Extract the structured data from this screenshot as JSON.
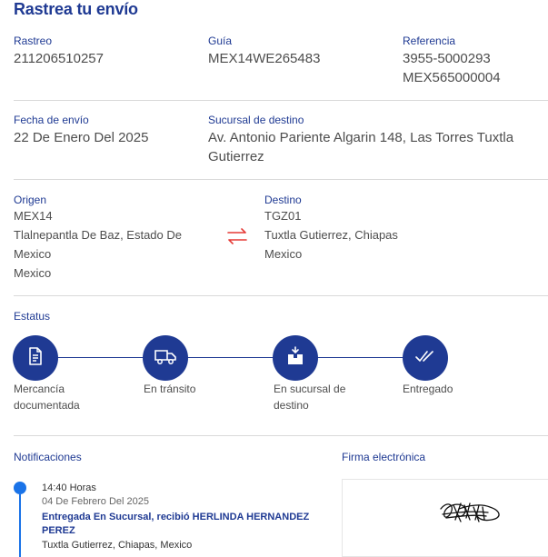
{
  "page": {
    "title": "Rastrea tu envío"
  },
  "shipment": {
    "rastreo_label": "Rastreo",
    "rastreo_value": "211206510257",
    "guia_label": "Guía",
    "guia_value": "MEX14WE265483",
    "referencia_label": "Referencia",
    "referencia_value_1": "3955-5000293",
    "referencia_value_2": "MEX565000004",
    "fecha_label": "Fecha de envío",
    "fecha_value": "22 De Enero Del 2025",
    "sucursal_label": "Sucursal de destino",
    "sucursal_value_1": "Av. Antonio Pariente Algarin 148, Las Torres Tuxtla",
    "sucursal_value_2": "Gutierrez"
  },
  "route": {
    "origen_label": "Origen",
    "origen_code": "MEX14",
    "origen_line_1": "Tlalnepantla De Baz, Estado De",
    "origen_line_2": "Mexico",
    "origen_line_3": "Mexico",
    "destino_label": "Destino",
    "destino_code": "TGZ01",
    "destino_line_1": "Tuxtla Gutierrez, Chiapas",
    "destino_line_2": "Mexico",
    "swap_icon": "swap-arrows-icon",
    "swap_color": "#e53935"
  },
  "status": {
    "label": "Estatus",
    "steps": [
      {
        "line_1": "Mercancía",
        "line_2": "documentada",
        "icon": "document-icon"
      },
      {
        "line_1": "En tránsito",
        "line_2": "",
        "icon": "truck-icon"
      },
      {
        "line_1": "En sucursal de",
        "line_2": "destino",
        "icon": "box-icon"
      },
      {
        "line_1": "Entregado",
        "line_2": "",
        "icon": "double-check-icon"
      }
    ],
    "accent": "#1f3a93"
  },
  "notifications": {
    "label": "Notificaciones",
    "events": [
      {
        "time": "14:40 Horas",
        "date": "04 De Febrero Del 2025",
        "desc": "Entregada En Sucursal, recibió HERLINDA HERNANDEZ PEREZ",
        "location": "Tuxtla Gutierrez, Chiapas, Mexico"
      }
    ],
    "dot_color": "#1a73e8"
  },
  "signature": {
    "label": "Firma electrónica"
  }
}
